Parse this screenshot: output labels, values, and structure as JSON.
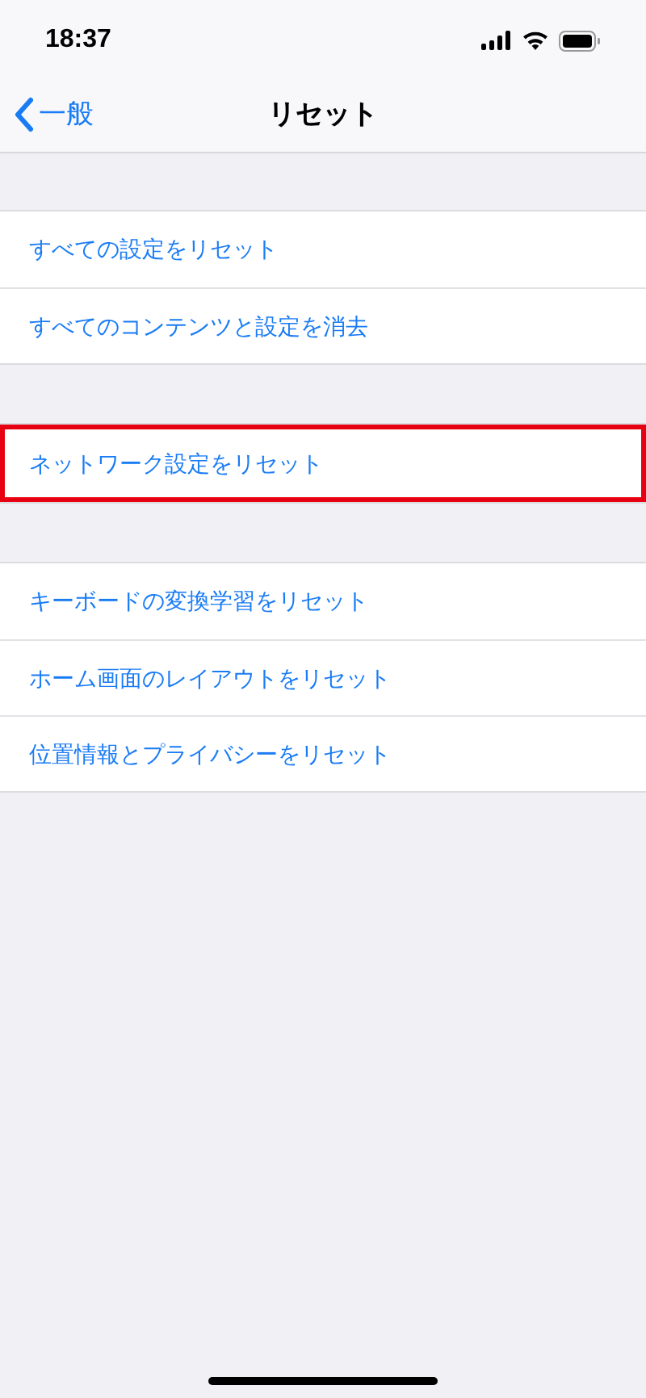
{
  "status_bar": {
    "time": "18:37"
  },
  "nav": {
    "back": "一般",
    "title": "リセット"
  },
  "groups": [
    {
      "items": [
        {
          "label": "すべての設定をリセット",
          "highlighted": false
        },
        {
          "label": "すべてのコンテンツと設定を消去",
          "highlighted": false
        }
      ]
    },
    {
      "items": [
        {
          "label": "ネットワーク設定をリセット",
          "highlighted": true
        }
      ]
    },
    {
      "items": [
        {
          "label": "キーボードの変換学習をリセット",
          "highlighted": false
        },
        {
          "label": "ホーム画面のレイアウトをリセット",
          "highlighted": false
        },
        {
          "label": "位置情報とプライバシーをリセット",
          "highlighted": false
        }
      ]
    }
  ]
}
